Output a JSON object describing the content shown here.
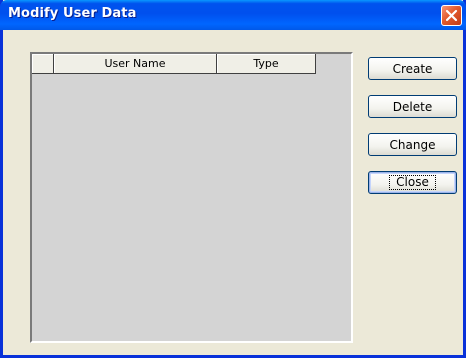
{
  "window": {
    "title": "Modify User Data",
    "close_icon": "close-icon",
    "accent": "#0054e3",
    "close_color": "#e25a2c"
  },
  "listview": {
    "columns": [
      "",
      "User Name",
      "Type"
    ],
    "rows": []
  },
  "buttons": {
    "create": "Create",
    "delete": "Delete",
    "change": "Change",
    "close": "Close"
  }
}
